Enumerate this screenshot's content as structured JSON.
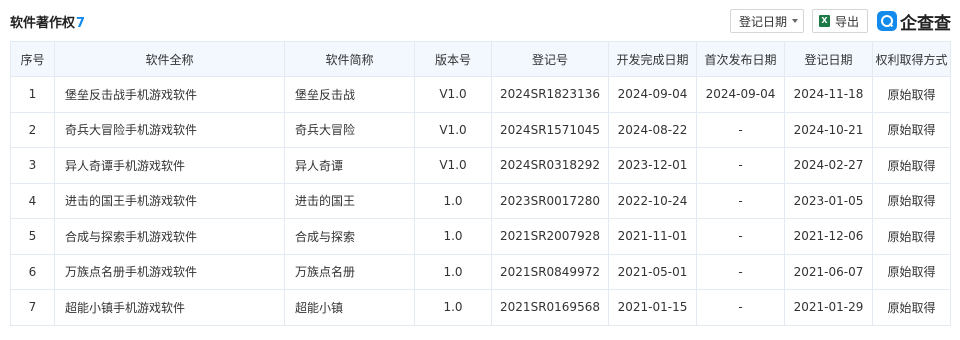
{
  "header": {
    "title": "软件著作权",
    "count": "7",
    "date_sort_label": "登记日期",
    "export_label": "导出",
    "logo_text": "企查查"
  },
  "colors": {
    "accent": "#128bed",
    "header_bg": "#f2f8fe",
    "border": "#e4eaf2",
    "excel_green": "#1d7a46"
  },
  "icons": [
    "caret-down-icon",
    "excel-icon",
    "qcc-logo-icon"
  ],
  "table": {
    "columns": [
      "序号",
      "软件全称",
      "软件简称",
      "版本号",
      "登记号",
      "开发完成日期",
      "首次发布日期",
      "登记日期",
      "权利取得方式"
    ],
    "rows": [
      [
        "1",
        "堡垒反击战手机游戏软件",
        "堡垒反击战",
        "V1.0",
        "2024SR1823136",
        "2024-09-04",
        "2024-09-04",
        "2024-11-18",
        "原始取得"
      ],
      [
        "2",
        "奇兵大冒险手机游戏软件",
        "奇兵大冒险",
        "V1.0",
        "2024SR1571045",
        "2024-08-22",
        "-",
        "2024-10-21",
        "原始取得"
      ],
      [
        "3",
        "异人奇谭手机游戏软件",
        "异人奇谭",
        "V1.0",
        "2024SR0318292",
        "2023-12-01",
        "-",
        "2024-02-27",
        "原始取得"
      ],
      [
        "4",
        "进击的国王手机游戏软件",
        "进击的国王",
        "1.0",
        "2023SR0017280",
        "2022-10-24",
        "-",
        "2023-01-05",
        "原始取得"
      ],
      [
        "5",
        "合成与探索手机游戏软件",
        "合成与探索",
        "1.0",
        "2021SR2007928",
        "2021-11-01",
        "-",
        "2021-12-06",
        "原始取得"
      ],
      [
        "6",
        "万族点名册手机游戏软件",
        "万族点名册",
        "1.0",
        "2021SR0849972",
        "2021-05-01",
        "-",
        "2021-06-07",
        "原始取得"
      ],
      [
        "7",
        "超能小镇手机游戏软件",
        "超能小镇",
        "1.0",
        "2021SR0169568",
        "2021-01-15",
        "-",
        "2021-01-29",
        "原始取得"
      ]
    ]
  }
}
